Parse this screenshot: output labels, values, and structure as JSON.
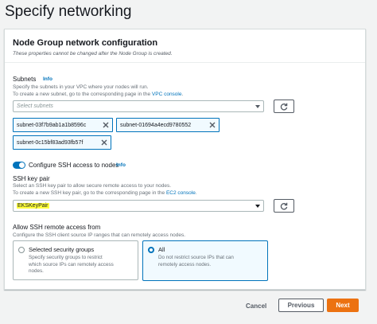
{
  "page": {
    "title": "Specify networking"
  },
  "panel": {
    "title": "Node Group network configuration",
    "subtitle": "These properties cannot be changed after the Node Group is created."
  },
  "subnets": {
    "label": "Subnets",
    "info": "Info",
    "desc1": "Specify the subnets in your VPC where your nodes will run.",
    "desc2_prefix": "To create a new subnet, go to the corresponding page in the",
    "desc2_link": "VPC console",
    "desc2_suffix": ".",
    "placeholder": "Select subnets",
    "tokens": [
      "subnet-03f7b9ab1a1b8596c",
      "subnet-01694a4ecd9780552",
      "subnet-0c15bf83ad93fb57f"
    ]
  },
  "ssh_toggle": {
    "label": "Configure SSH access to nodes",
    "info": "Info",
    "enabled": true
  },
  "ssh_key": {
    "label": "SSH key pair",
    "desc1": "Select an SSH key pair to allow secure remote access to your nodes.",
    "desc2_prefix": "To create a new SSH key pair, go to the corresponding page in the",
    "desc2_link": "EC2 console",
    "desc2_suffix": ".",
    "value": "EKSKeyPair"
  },
  "ssh_from": {
    "label": "Allow SSH remote access from",
    "desc": "Configure the SSH client source IP ranges that can remotely access nodes.",
    "options": [
      {
        "title": "Selected security groups",
        "desc1": "Specify security groups to restrict",
        "desc2": "which source IPs can remotely access",
        "desc3": "nodes.",
        "selected": false
      },
      {
        "title": "All",
        "desc1": "Do not restrict source IPs that can",
        "desc2": "remotely access nodes.",
        "desc3": "",
        "selected": true
      }
    ]
  },
  "footer": {
    "cancel": "Cancel",
    "previous": "Previous",
    "next": "Next"
  },
  "colors": {
    "accent": "#0073bb",
    "primary_button": "#ec7211",
    "highlight": "#ffff3c"
  },
  "icons": {
    "refresh": "refresh-icon",
    "remove": "close-icon",
    "dropdown": "caret-down-icon"
  }
}
